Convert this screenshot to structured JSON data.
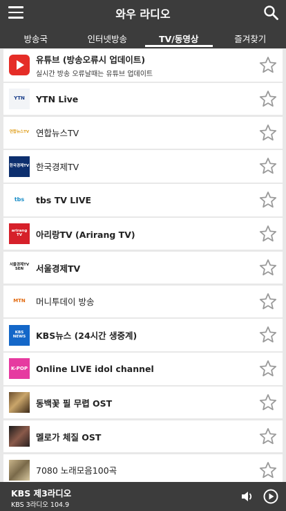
{
  "header": {
    "title": "와우 라디오"
  },
  "tabs": [
    {
      "label": "방송국"
    },
    {
      "label": "인터넷방송"
    },
    {
      "label": "TV/동영상"
    },
    {
      "label": "즐겨찾기"
    }
  ],
  "items": [
    {
      "name": "유튜브 (방송오류시 업데이트)",
      "sub": "실시간 방송 오류날때는 유튜브 업데이트",
      "thumb": "youtube-icon"
    },
    {
      "name": "YTN Live",
      "thumb": "ytn-logo",
      "thumb_text": "YTN"
    },
    {
      "name": "연합뉴스TV",
      "thumb": "yonhap-logo",
      "thumb_text": "연합뉴스TV"
    },
    {
      "name": "한국경제TV",
      "thumb": "hankyung-logo",
      "thumb_text": "한국경제TV"
    },
    {
      "name": "tbs TV LIVE",
      "thumb": "tbs-logo",
      "thumb_text": "tbs"
    },
    {
      "name": "아리랑TV (Arirang TV)",
      "thumb": "arirang-logo",
      "thumb_text": "arirang TV"
    },
    {
      "name": "서울경제TV",
      "thumb": "sentv-logo",
      "thumb_text": "서울경제TV SEN"
    },
    {
      "name": "머니투데이 방송",
      "thumb": "mtn-logo",
      "thumb_text": "MTN"
    },
    {
      "name": "KBS뉴스 (24시간 생중계)",
      "thumb": "kbs-news-logo",
      "thumb_text": "KBS NEWS"
    },
    {
      "name": "Online LIVE idol channel",
      "thumb": "kpop-logo",
      "thumb_text": "K-POP"
    },
    {
      "name": "동백꽃 필 무렵 OST",
      "thumb": "drama-poster-image"
    },
    {
      "name": "멜로가 체질 OST",
      "thumb": "drama-poster-image"
    },
    {
      "name": "7080 노래모음100곡",
      "thumb": "album-cover-image"
    }
  ],
  "player": {
    "station": "KBS 제3라디오",
    "sub": "KBS 3라디오 104.9"
  },
  "colors": {
    "bar": "#3c3c3c",
    "background": "#e8e8e8",
    "star": "#9a9a9a"
  }
}
